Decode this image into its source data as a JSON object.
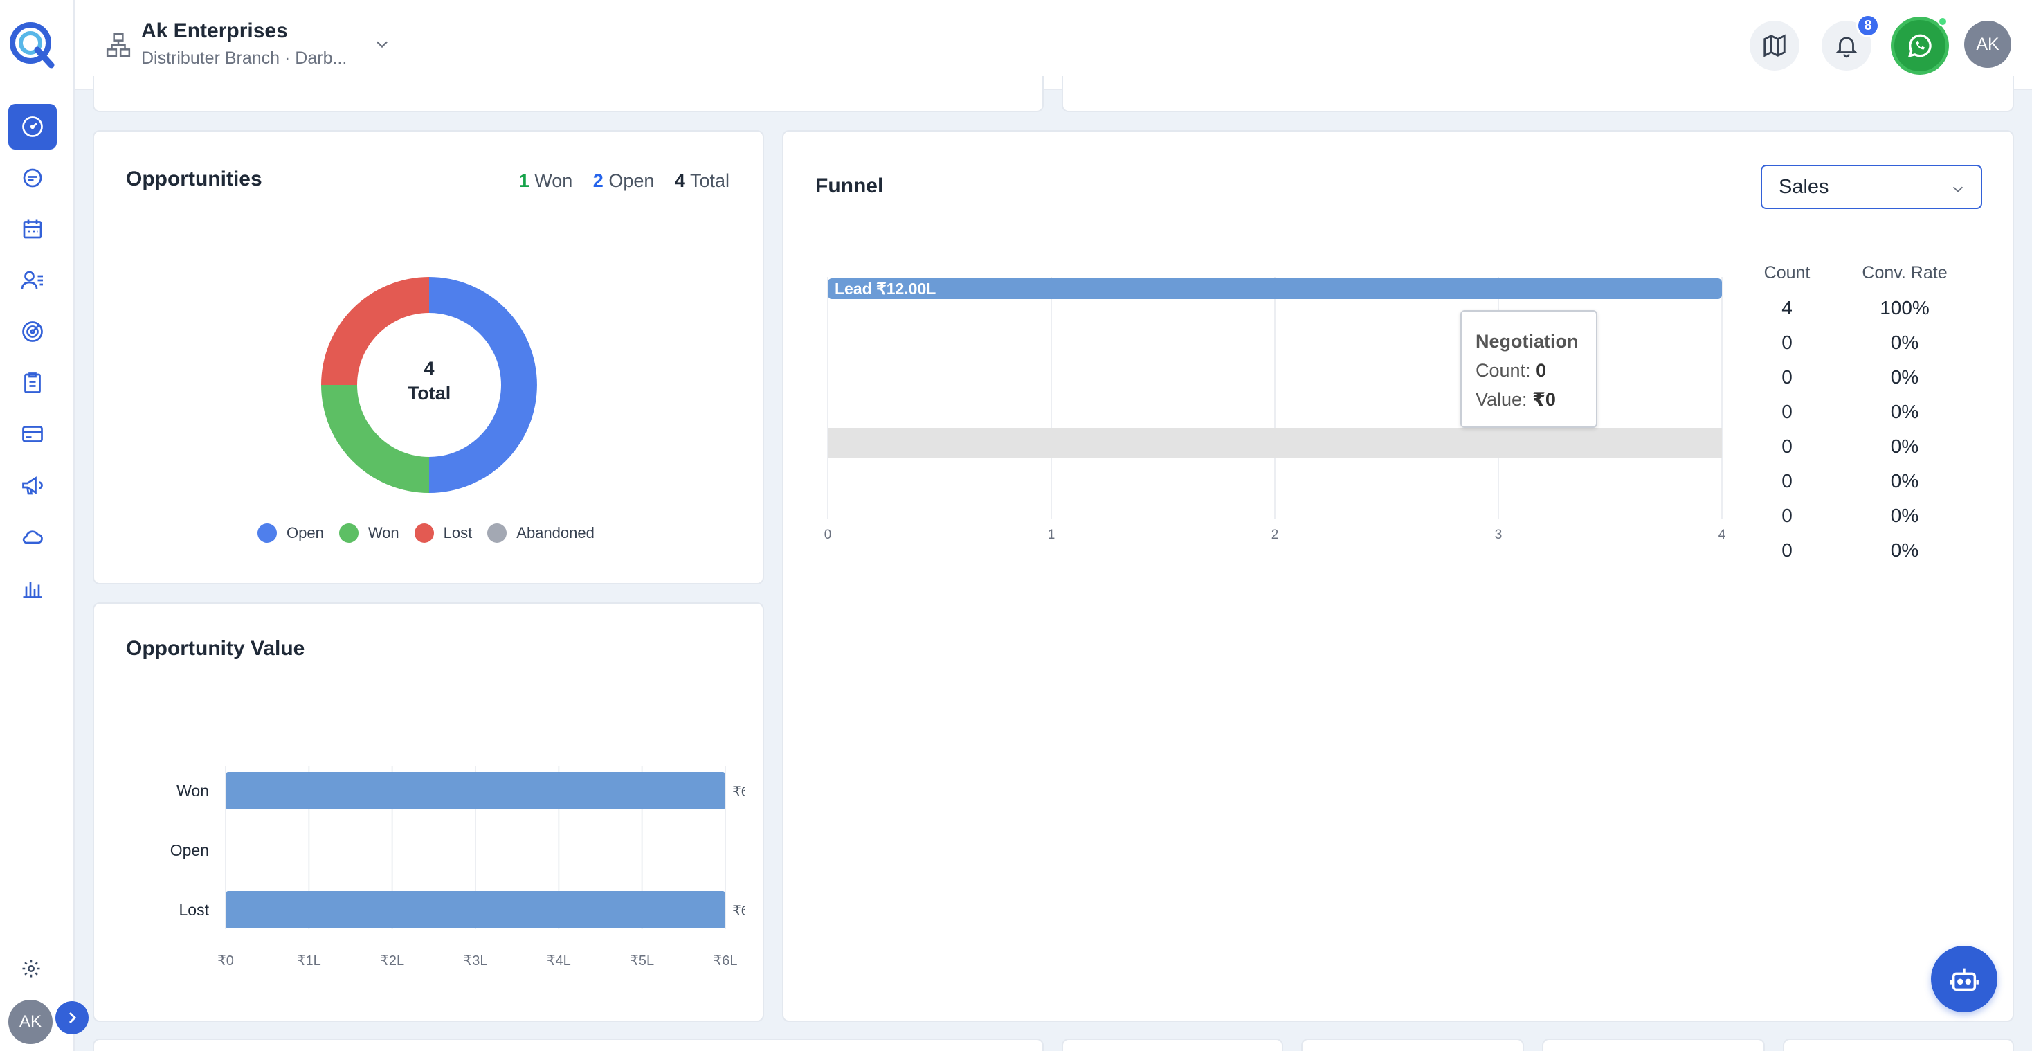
{
  "header": {
    "org_name": "Ak Enterprises",
    "org_subtitle": "Distributer Branch · Darb...",
    "notification_count": "8",
    "avatar_initials": "AK"
  },
  "sidebar": {
    "items": [
      {
        "icon": "dashboard-icon",
        "active": true
      },
      {
        "icon": "chat-icon",
        "active": false
      },
      {
        "icon": "calendar-icon",
        "active": false
      },
      {
        "icon": "contacts-icon",
        "active": false
      },
      {
        "icon": "target-icon",
        "active": false
      },
      {
        "icon": "clipboard-icon",
        "active": false
      },
      {
        "icon": "card-icon",
        "active": false
      },
      {
        "icon": "megaphone-icon",
        "active": false
      },
      {
        "icon": "cloud-icon",
        "active": false
      },
      {
        "icon": "bar-chart-icon",
        "active": false
      }
    ],
    "avatar_initials": "AK"
  },
  "opportunities": {
    "title": "Opportunities",
    "won_count": "1",
    "won_label": "Won",
    "open_count": "2",
    "open_label": "Open",
    "total_count": "4",
    "total_label": "Total",
    "center_value": "4",
    "center_label": "Total",
    "legend": [
      {
        "label": "Open",
        "color": "#4f7fec"
      },
      {
        "label": "Won",
        "color": "#5dbf64"
      },
      {
        "label": "Lost",
        "color": "#e35a52"
      },
      {
        "label": "Abandoned",
        "color": "#a3a8b3"
      }
    ]
  },
  "opportunity_value": {
    "title": "Opportunity Value"
  },
  "funnel": {
    "title": "Funnel",
    "select_value": "Sales",
    "tooltip": {
      "title": "Negotiation",
      "count_label": "Count:",
      "count_value": "0",
      "value_label": "Value:",
      "value_value": "₹0"
    },
    "table": {
      "headers": [
        "Count",
        "Conv. Rate"
      ],
      "rows": [
        [
          "4",
          "100%"
        ],
        [
          "0",
          "0%"
        ],
        [
          "0",
          "0%"
        ],
        [
          "0",
          "0%"
        ],
        [
          "0",
          "0%"
        ],
        [
          "0",
          "0%"
        ],
        [
          "0",
          "0%"
        ],
        [
          "0",
          "0%"
        ]
      ]
    }
  },
  "chart_data": [
    {
      "type": "pie",
      "title": "Opportunities",
      "categories": [
        "Open",
        "Won",
        "Lost",
        "Abandoned"
      ],
      "values": [
        2,
        1,
        1,
        0
      ],
      "colors": [
        "#4f7fec",
        "#5dbf64",
        "#e35a52",
        "#a3a8b3"
      ],
      "legend": "bottom"
    },
    {
      "type": "bar",
      "orientation": "horizontal",
      "title": "Opportunity Value",
      "categories": [
        "Won",
        "Open",
        "Lost"
      ],
      "values": [
        600000,
        0,
        600000
      ],
      "data_labels": [
        "₹6",
        "",
        "₹6"
      ],
      "x_ticks": [
        "₹0",
        "₹1L",
        "₹2L",
        "₹3L",
        "₹4L",
        "₹5L",
        "₹6L"
      ],
      "xlim": [
        0,
        600000
      ],
      "bar_color": "#6b9bd6",
      "grid": true
    },
    {
      "type": "bar",
      "orientation": "horizontal",
      "title": "Funnel",
      "categories": [
        "Lead",
        "",
        "",
        "",
        "",
        "",
        "",
        ""
      ],
      "values": [
        4,
        0,
        0,
        0,
        0,
        0,
        0,
        0
      ],
      "data_labels": [
        "Lead  ₹12.00L"
      ],
      "x_ticks": [
        "0",
        "1",
        "2",
        "3",
        "4"
      ],
      "xlim": [
        0,
        4
      ],
      "bar_color": "#6b9bd6",
      "grid": true
    }
  ]
}
